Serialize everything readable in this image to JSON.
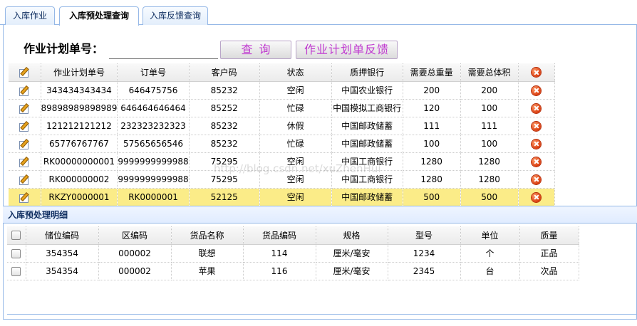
{
  "tabs": [
    {
      "label": "入库作业"
    },
    {
      "label": "入库预处理查询"
    },
    {
      "label": "入库反馈查询"
    }
  ],
  "search": {
    "label": "作业计划单号：",
    "value": "",
    "query_button": "查询",
    "feedback_button": "作业计划单反馈"
  },
  "main_table": {
    "headers": [
      "作业计划单号",
      "订单号",
      "客户码",
      "状态",
      "质押银行",
      "需要总重量",
      "需要总体积"
    ],
    "rows": [
      [
        "343434343434",
        "646475756",
        "85232",
        "空闲",
        "中国农业银行",
        "200",
        "200"
      ],
      [
        "89898989898989",
        "646464646464",
        "85252",
        "忙碌",
        "中国模拟工商银行",
        "120",
        "100"
      ],
      [
        "121212121212",
        "232323232323",
        "85232",
        "休假",
        "中国邮政储蓄",
        "111",
        "111"
      ],
      [
        "65776767767",
        "57565656546",
        "85232",
        "忙碌",
        "中国邮政储蓄",
        "100",
        "100"
      ],
      [
        "RK00000000001",
        "9999999999988",
        "75295",
        "空闲",
        "中国工商银行",
        "1280",
        "1280"
      ],
      [
        "RK000000002",
        "9999999999988",
        "75295",
        "空闲",
        "中国工商银行",
        "1280",
        "1280"
      ],
      [
        "RKZY0000001",
        "RK0000001",
        "52125",
        "空闲",
        "中国邮政储蓄",
        "500",
        "500"
      ]
    ],
    "selected_row": 6
  },
  "detail": {
    "title": "入库预处理明细",
    "headers": [
      "储位编码",
      "区编码",
      "货品名称",
      "货品编码",
      "规格",
      "型号",
      "单位",
      "质量"
    ],
    "rows": [
      [
        "354354",
        "000002",
        "联想",
        "114",
        "厘米/毫安",
        "1234",
        "个",
        "正品"
      ],
      [
        "354354",
        "000002",
        "苹果",
        "116",
        "厘米/毫安",
        "2345",
        "台",
        "次品"
      ]
    ]
  },
  "watermark": "http://blog.csdn.net/xuZhenHui",
  "icons": {
    "edit": "edit-icon",
    "delete": "delete-icon",
    "checkbox": "checkbox-icon"
  },
  "colors": {
    "tab_border": "#95b8e7",
    "selected_row": "#fbec88",
    "button_text": "#c03ad0",
    "delete_icon": "#d93a0c"
  }
}
